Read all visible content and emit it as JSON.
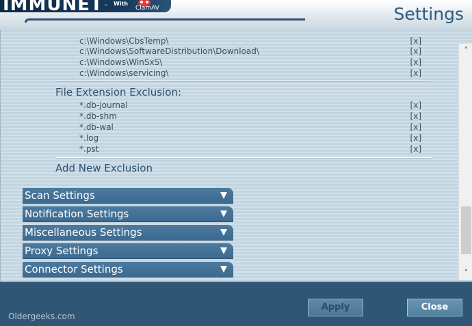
{
  "header": {
    "brand": "IMMUNET",
    "with_label": "With",
    "clam_logo": "ClamAV",
    "page_title": "Settings"
  },
  "exclusions": {
    "paths": [
      {
        "text": "c:\\Windows\\CbsTemp\\",
        "remove": "[x]"
      },
      {
        "text": "c:\\Windows\\SoftwareDistribution\\Download\\",
        "remove": "[x]"
      },
      {
        "text": "c:\\Windows\\WinSxS\\",
        "remove": "[x]"
      },
      {
        "text": "c:\\Windows\\servicing\\",
        "remove": "[x]"
      }
    ],
    "extension_heading": "File Extension Exclusion:",
    "extensions": [
      {
        "text": "*.db-journal",
        "remove": "[x]"
      },
      {
        "text": "*.db-shm",
        "remove": "[x]"
      },
      {
        "text": "*.db-wal",
        "remove": "[x]"
      },
      {
        "text": "*.log",
        "remove": "[x]"
      },
      {
        "text": "*.pst",
        "remove": "[x]"
      }
    ],
    "add_new": "Add New Exclusion"
  },
  "sections": [
    {
      "label": "Scan Settings",
      "icon": "triangle-down-icon"
    },
    {
      "label": "Notification Settings",
      "icon": "triangle-down-icon"
    },
    {
      "label": "Miscellaneous Settings",
      "icon": "triangle-down-icon"
    },
    {
      "label": "Proxy Settings",
      "icon": "triangle-down-icon"
    },
    {
      "label": "Connector Settings",
      "icon": "triangle-down-icon"
    }
  ],
  "scrollbar": {
    "up_icon": "chevron-up-icon",
    "down_icon": "chevron-down-icon",
    "up_glyph": "˄",
    "down_glyph": "˅"
  },
  "footer": {
    "watermark": "Oldergeeks.com",
    "apply_label": "Apply",
    "close_label": "Close"
  },
  "colors": {
    "accent": "#3c6a90",
    "footer": "#2f5675",
    "title": "#2c5a7d"
  }
}
